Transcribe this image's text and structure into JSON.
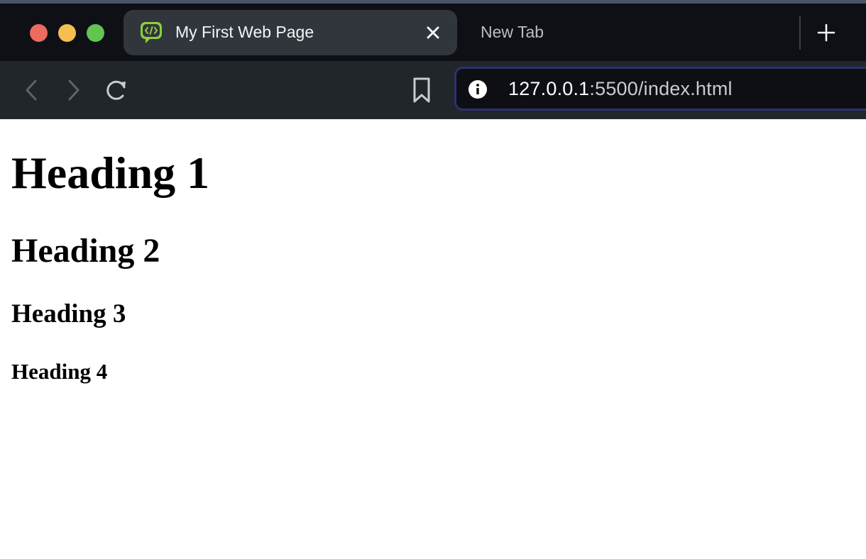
{
  "window": {
    "controls": [
      "close",
      "minimize",
      "maximize"
    ],
    "colors": {
      "close": "#ed6a5e",
      "minimize": "#f4bf4f",
      "maximize": "#61c554"
    }
  },
  "tabs": {
    "active": {
      "title": "My First Web Page",
      "favicon": "code-chat-icon",
      "favicon_color": "#8fcf3a"
    },
    "inactive": {
      "title": "New Tab"
    }
  },
  "toolbar": {
    "icons": [
      "chevron-left-icon",
      "chevron-right-icon",
      "reload-icon",
      "bookmark-icon"
    ],
    "address": {
      "host": "127.0.0.1",
      "path": ":5500/index.html",
      "info_icon": "info-icon"
    }
  },
  "page": {
    "h1": "Heading 1",
    "h2": "Heading 2",
    "h3": "Heading 3",
    "h4": "Heading 4"
  }
}
